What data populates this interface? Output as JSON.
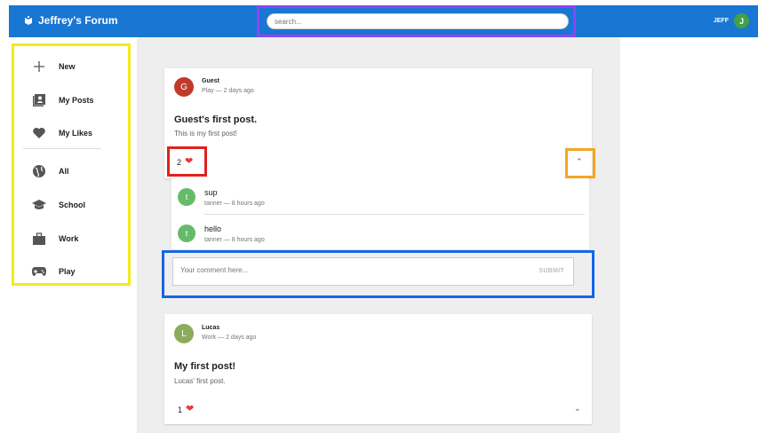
{
  "app": {
    "title": "Jeffrey's Forum"
  },
  "search": {
    "placeholder": "search..."
  },
  "user": {
    "name": "JEFF",
    "initial": "J",
    "avatar_color": "#43a047"
  },
  "sidebar": {
    "items": [
      {
        "label": "New",
        "icon": "plus-icon"
      },
      {
        "label": "My Posts",
        "icon": "posts-icon"
      },
      {
        "label": "My Likes",
        "icon": "heart-icon"
      },
      {
        "label": "All",
        "icon": "globe-icon"
      },
      {
        "label": "School",
        "icon": "school-icon"
      },
      {
        "label": "Work",
        "icon": "briefcase-icon"
      },
      {
        "label": "Play",
        "icon": "gamepad-icon"
      }
    ]
  },
  "posts": [
    {
      "author": "Guest",
      "initial": "G",
      "meta": "Play — 2 days ago",
      "title": "Guest's first post.",
      "body": "This is my first post!",
      "likes": "2",
      "avatar_color": "#c0392b",
      "comments": [
        {
          "initial": "t",
          "text": "sup",
          "meta": "tanner — 8 hours ago"
        },
        {
          "initial": "t",
          "text": "hello",
          "meta": "tanner — 8 hours ago"
        }
      ],
      "comment_placeholder": "Your comment here...",
      "submit_label": "SUBMIT"
    },
    {
      "author": "Lucas",
      "initial": "L",
      "meta": "Work — 2 days ago",
      "title": "My first post!",
      "body": "Lucas' first post.",
      "likes": "1",
      "avatar_color": "#8bab5d"
    }
  ],
  "colors": {
    "appbar": "#1976d2",
    "highlight_search": "#8e44f5",
    "highlight_sidebar": "#f2eb1e",
    "highlight_likes": "#e02020",
    "highlight_collapse": "#f5a623",
    "highlight_comment": "#1565e8",
    "heart": "#e53935",
    "comment_avatar": "#66bb6a"
  }
}
